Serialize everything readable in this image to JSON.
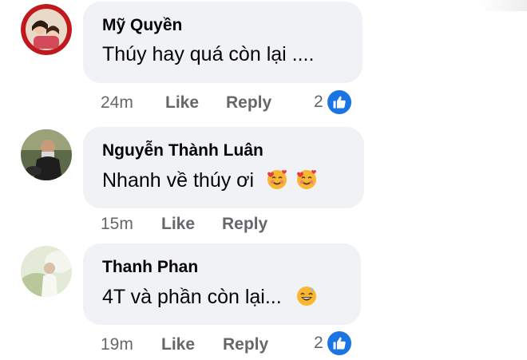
{
  "comments": [
    {
      "author": "Mỹ Quyền",
      "text": "Thúy hay quá còn lại ....",
      "time": "24m",
      "like_label": "Like",
      "reply_label": "Reply",
      "reaction_count": "2",
      "emojis": []
    },
    {
      "author": "Nguyễn Thành Luân",
      "text": "Nhanh về thúy ơi",
      "time": "15m",
      "like_label": "Like",
      "reply_label": "Reply",
      "reaction_count": "",
      "emojis": [
        "smiling-face-with-hearts-icon",
        "smiling-face-with-hearts-icon"
      ]
    },
    {
      "author": "Thanh Phan",
      "text": "4T và phần còn lại...",
      "time": "19m",
      "like_label": "Like",
      "reply_label": "Reply",
      "reaction_count": "2",
      "emojis": [
        "grinning-face-with-sweat-icon"
      ]
    }
  ],
  "colors": {
    "bubble": "#f0f2f5",
    "name": "#050505",
    "meta": "#65676b",
    "like_badge": "#1b74e4"
  }
}
